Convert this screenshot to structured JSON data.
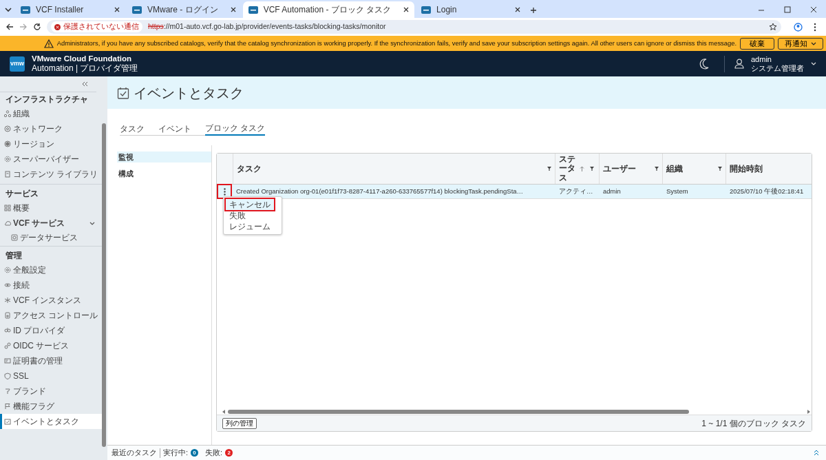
{
  "browser": {
    "tabs": [
      {
        "title": "VCF Installer",
        "selected": false
      },
      {
        "title": "VMware - ログイン",
        "selected": false
      },
      {
        "title": "VCF Automation - ブロック タスク",
        "selected": true
      },
      {
        "title": "Login",
        "selected": false
      }
    ],
    "security_label": "保護されていない通信",
    "url_scheme": "https",
    "url_rest": "://m01-auto.vcf.go-lab.jp/provider/events-tasks/blocking-tasks/monitor"
  },
  "banner": {
    "message": "Administrators, if you have any subscribed catalogs, verify that the catalog synchronization is working properly. If the synchronization fails, verify and save your subscription settings again. All other users can ignore or dismiss this message.",
    "buttons": [
      {
        "label": "破棄",
        "kind": "plain"
      },
      {
        "label": "再通知",
        "kind": "dropdown"
      }
    ]
  },
  "header": {
    "logo": "vmw",
    "title": "VMware Cloud Foundation",
    "subtitle": "Automation | プロバイダ管理",
    "user_name": "admin",
    "user_role": "システム管理者"
  },
  "sidebar": {
    "sections": [
      {
        "heading": "インフラストラクチャ",
        "items": [
          {
            "label": "組織",
            "selected": false
          },
          {
            "label": "ネットワーク",
            "selected": false
          },
          {
            "label": "リージョン",
            "selected": false
          },
          {
            "label": "スーパーバイザー",
            "selected": false
          },
          {
            "label": "コンテンツ ライブラリ",
            "selected": false
          }
        ]
      },
      {
        "heading": "サービス",
        "items": [
          {
            "label": "概要",
            "selected": false
          },
          {
            "label": "VCF サービス",
            "selected": false,
            "expanded": true,
            "children": [
              {
                "label": "データサービス",
                "selected": false
              }
            ]
          }
        ]
      },
      {
        "heading": "管理",
        "items": [
          {
            "label": "全般設定",
            "selected": false
          },
          {
            "label": "接続",
            "selected": false
          },
          {
            "label": "VCF インスタンス",
            "selected": false
          },
          {
            "label": "アクセス コントロール",
            "selected": false
          },
          {
            "label": "ID プロバイダ",
            "selected": false
          },
          {
            "label": "OIDC サービス",
            "selected": false
          },
          {
            "label": "証明書の管理",
            "selected": false
          },
          {
            "label": "SSL",
            "selected": false
          },
          {
            "label": "ブランド",
            "selected": false
          },
          {
            "label": "機能フラグ",
            "selected": false
          },
          {
            "label": "イベントとタスク",
            "selected": true
          }
        ]
      }
    ]
  },
  "page_title": "イベントとタスク",
  "tabs": [
    {
      "label": "タスク",
      "selected": false
    },
    {
      "label": "イベント",
      "selected": false
    },
    {
      "label": "ブロック タスク",
      "selected": true
    }
  ],
  "subnav": [
    {
      "label": "監視",
      "selected": true
    },
    {
      "label": "構成",
      "selected": false
    }
  ],
  "table": {
    "columns": [
      {
        "label": "タスク",
        "filter": true,
        "sorted_ascending": false
      },
      {
        "label": "ステータス",
        "filter": true,
        "sorted_ascending": true
      },
      {
        "label": "ユーザー",
        "filter": true,
        "sorted_ascending": false
      },
      {
        "label": "組織",
        "filter": true,
        "sorted_ascending": false
      },
      {
        "label": "開始時刻",
        "filter": false,
        "sorted_ascending": false
      }
    ],
    "rows": [
      {
        "cells": [
          "Created Organization org-01(e01f1f73-8287-4117-a260-633765577f14) blockingTask.pendingSta…",
          "アクティ…",
          "admin",
          "System",
          "2025/07/10 午後02:18:41"
        ],
        "selected": true,
        "action_highlighted": true
      }
    ],
    "action_menu": [
      {
        "label": "キャンセル",
        "highlighted": true
      },
      {
        "label": "失敗",
        "highlighted": false
      },
      {
        "label": "レジューム",
        "highlighted": false
      }
    ],
    "manage_columns": "列の管理",
    "footer": "1 ~ 1/1 個のブロック タスク"
  },
  "status_bar": {
    "label": "最近のタスク",
    "running_label": "実行中:",
    "running_count": "0",
    "failed_label": "失敗:",
    "failed_count": "2"
  }
}
